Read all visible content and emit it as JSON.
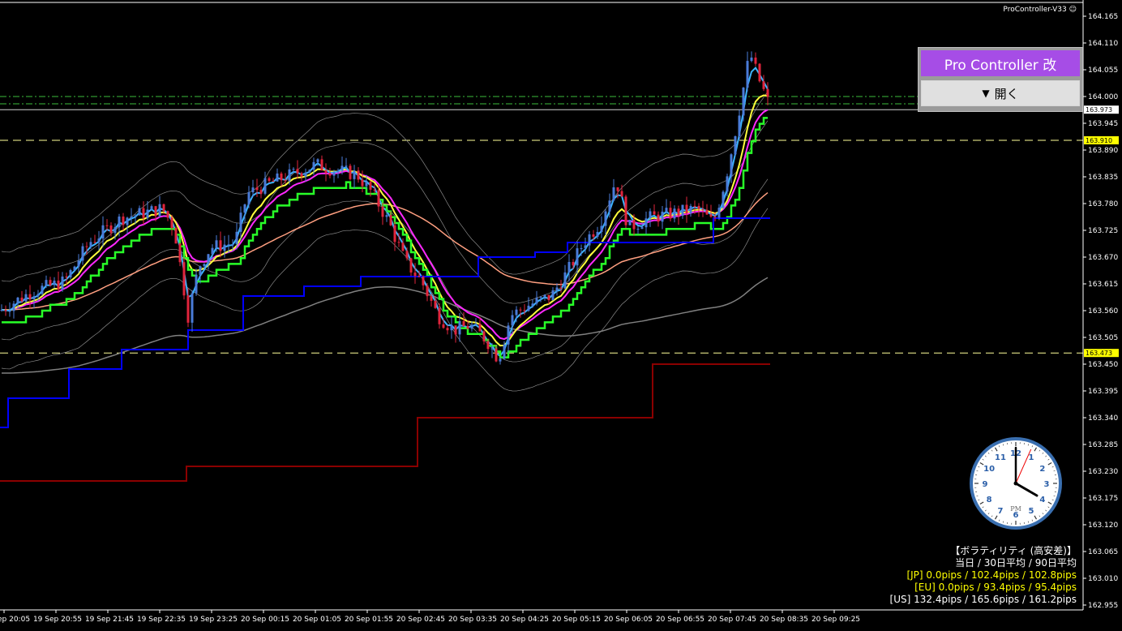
{
  "ea_title": "ProController-V33",
  "ea_title_icon": "smiley-icon",
  "price_axis": {
    "ticks": [
      "164.165",
      "164.110",
      "164.055",
      "164.000",
      "163.945",
      "163.890",
      "163.835",
      "163.780",
      "163.725",
      "163.670",
      "163.615",
      "163.560",
      "163.505",
      "163.450",
      "163.395",
      "163.340",
      "163.285",
      "163.230",
      "163.175",
      "163.120",
      "163.065",
      "163.010",
      "162.955"
    ],
    "current_label": "163.973",
    "upper_line_label": "163.910",
    "lower_line_label": "163.473"
  },
  "time_axis": {
    "ticks": [
      "19 Sep 20:05",
      "19 Sep 20:55",
      "19 Sep 21:45",
      "19 Sep 22:35",
      "19 Sep 23:25",
      "20 Sep 00:15",
      "20 Sep 01:05",
      "20 Sep 01:55",
      "20 Sep 02:45",
      "20 Sep 03:35",
      "20 Sep 04:25",
      "20 Sep 05:15",
      "20 Sep 06:05",
      "20 Sep 06:55",
      "20 Sep 07:45",
      "20 Sep 08:35",
      "20 Sep 09:25"
    ]
  },
  "pro_controller": {
    "title": "Pro Controller 改",
    "open_button": "開く",
    "open_icon": "triangle-down-icon"
  },
  "volatility": {
    "title": "【ボラティリティ (高安差)】",
    "header": "当日 / 30日平均 / 90日平均",
    "jp": "[JP] 0.0pips / 102.4pips / 102.8pips",
    "eu": "[EU] 0.0pips / 93.4pips / 95.4pips",
    "us": "[US] 132.4pips / 165.6pips / 161.2pips"
  },
  "clock": {
    "period": "PM",
    "numbers": [
      "12",
      "1",
      "2",
      "3",
      "4",
      "5",
      "6",
      "7",
      "8",
      "9",
      "10",
      "11"
    ],
    "hour": 4,
    "minute": 0,
    "second": 4
  },
  "colors": {
    "bull_candle": "#4a7bd8",
    "bear_candle": "#e0243c",
    "bollinger": "#8a8a8a",
    "ma_fast": "#3cb4ff",
    "ma_yellow": "#ffff3c",
    "ma_magenta": "#ff28ff",
    "ma_green": "#28ff28",
    "ma_salmon": "#ff9f80",
    "ma_gray": "#808080",
    "channel_blue": "#0000ff",
    "channel_darkred": "#8b0000",
    "hline_yellow": "#ffff99",
    "hline_green": "#3cbc3c",
    "price_label_bg": "#ffff00",
    "current_label_bg": "#ffffff"
  }
}
